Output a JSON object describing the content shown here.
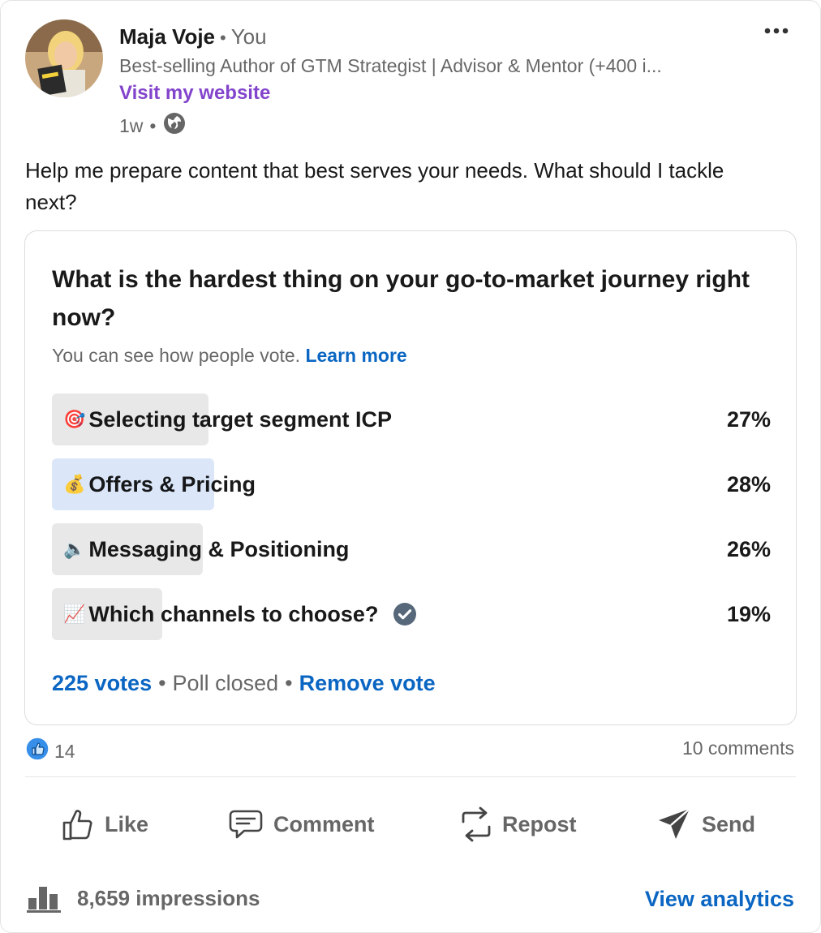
{
  "author": {
    "name": "Maja Voje",
    "relation": "You",
    "headline": "Best-selling Author of GTM Strategist | Advisor & Mentor (+400 i...",
    "website_link": "Visit my website",
    "time": "1w",
    "visibility_icon": "globe-icon"
  },
  "post": {
    "text": "Help me prepare content that best serves your needs. What should I tackle next?"
  },
  "poll": {
    "question": "What is the hardest thing on your go-to-market journey right now?",
    "note": "You can see how people vote.",
    "learn_more": "Learn more",
    "options": [
      {
        "emoji": "🎯",
        "label": "Selecting target segment ICP",
        "percent": "27%",
        "share": 27,
        "selected": false
      },
      {
        "emoji": "💰",
        "label": "Offers & Pricing",
        "percent": "28%",
        "share": 28,
        "selected": true
      },
      {
        "emoji": "🔈",
        "label": " Messaging & Positioning",
        "percent": "26%",
        "share": 26,
        "selected": false
      },
      {
        "emoji": "📈",
        "label": " Which channels to choose?",
        "percent": "19%",
        "share": 19,
        "selected": false
      }
    ],
    "votes": "225 votes",
    "status": "Poll closed",
    "remove_vote": "Remove vote"
  },
  "social": {
    "reactions": "14",
    "comments": "10 comments"
  },
  "actions": {
    "like": "Like",
    "comment": "Comment",
    "repost": "Repost",
    "send": "Send"
  },
  "stats": {
    "impressions": "8,659 impressions",
    "view_analytics": "View analytics"
  },
  "colors": {
    "link_blue": "#0a66c2",
    "website_purple": "#8344cc",
    "selected_bar": "#dbe7f9",
    "result_bar": "#e8e8e8"
  }
}
